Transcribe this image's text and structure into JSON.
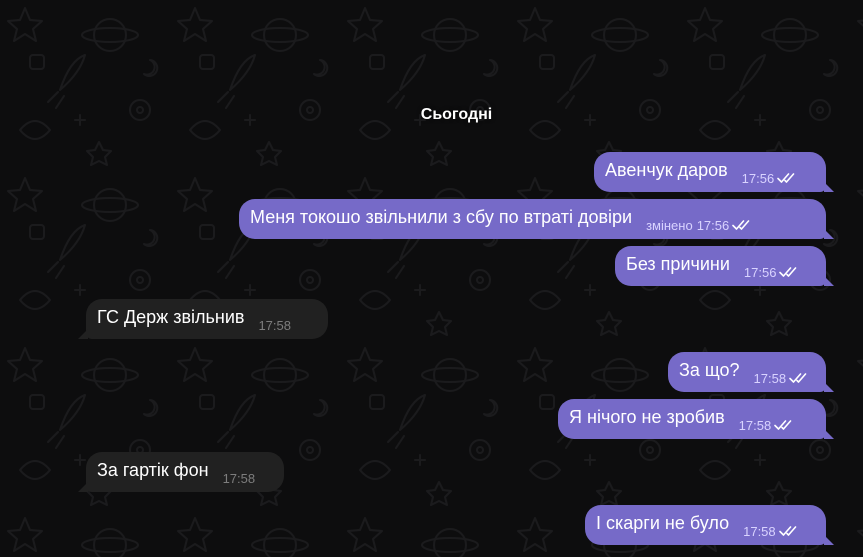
{
  "chat": {
    "date_label": "Сьогодні",
    "messages": [
      {
        "text": "Авенчук даров",
        "time": "17:56",
        "direction": "out",
        "status": "read"
      },
      {
        "text": "Меня токошо звільнили з сбу по втраті довіри",
        "time": "17:56",
        "edited": "змінено",
        "direction": "out",
        "status": "read"
      },
      {
        "text": "Без причини",
        "time": "17:56",
        "direction": "out",
        "status": "read"
      },
      {
        "text": "ГС Держ звільнив",
        "time": "17:58",
        "direction": "in"
      },
      {
        "text": "За що?",
        "time": "17:58",
        "direction": "out",
        "status": "read"
      },
      {
        "text": "Я нічого не зробив",
        "time": "17:58",
        "direction": "out",
        "status": "read"
      },
      {
        "text": "За гартік фон",
        "time": "17:58",
        "direction": "in"
      },
      {
        "text": "І скарги не було",
        "time": "17:58",
        "direction": "out",
        "status": "read"
      }
    ]
  },
  "colors": {
    "background": "#0d0d0e",
    "outgoing_bubble": "#766ac8",
    "incoming_bubble": "#212121",
    "outgoing_meta": "#d9d3ff",
    "incoming_meta": "#7d7d7d"
  },
  "icons": {
    "read_status": "double-check-icon",
    "wallpaper": "space-doodle-pattern"
  }
}
